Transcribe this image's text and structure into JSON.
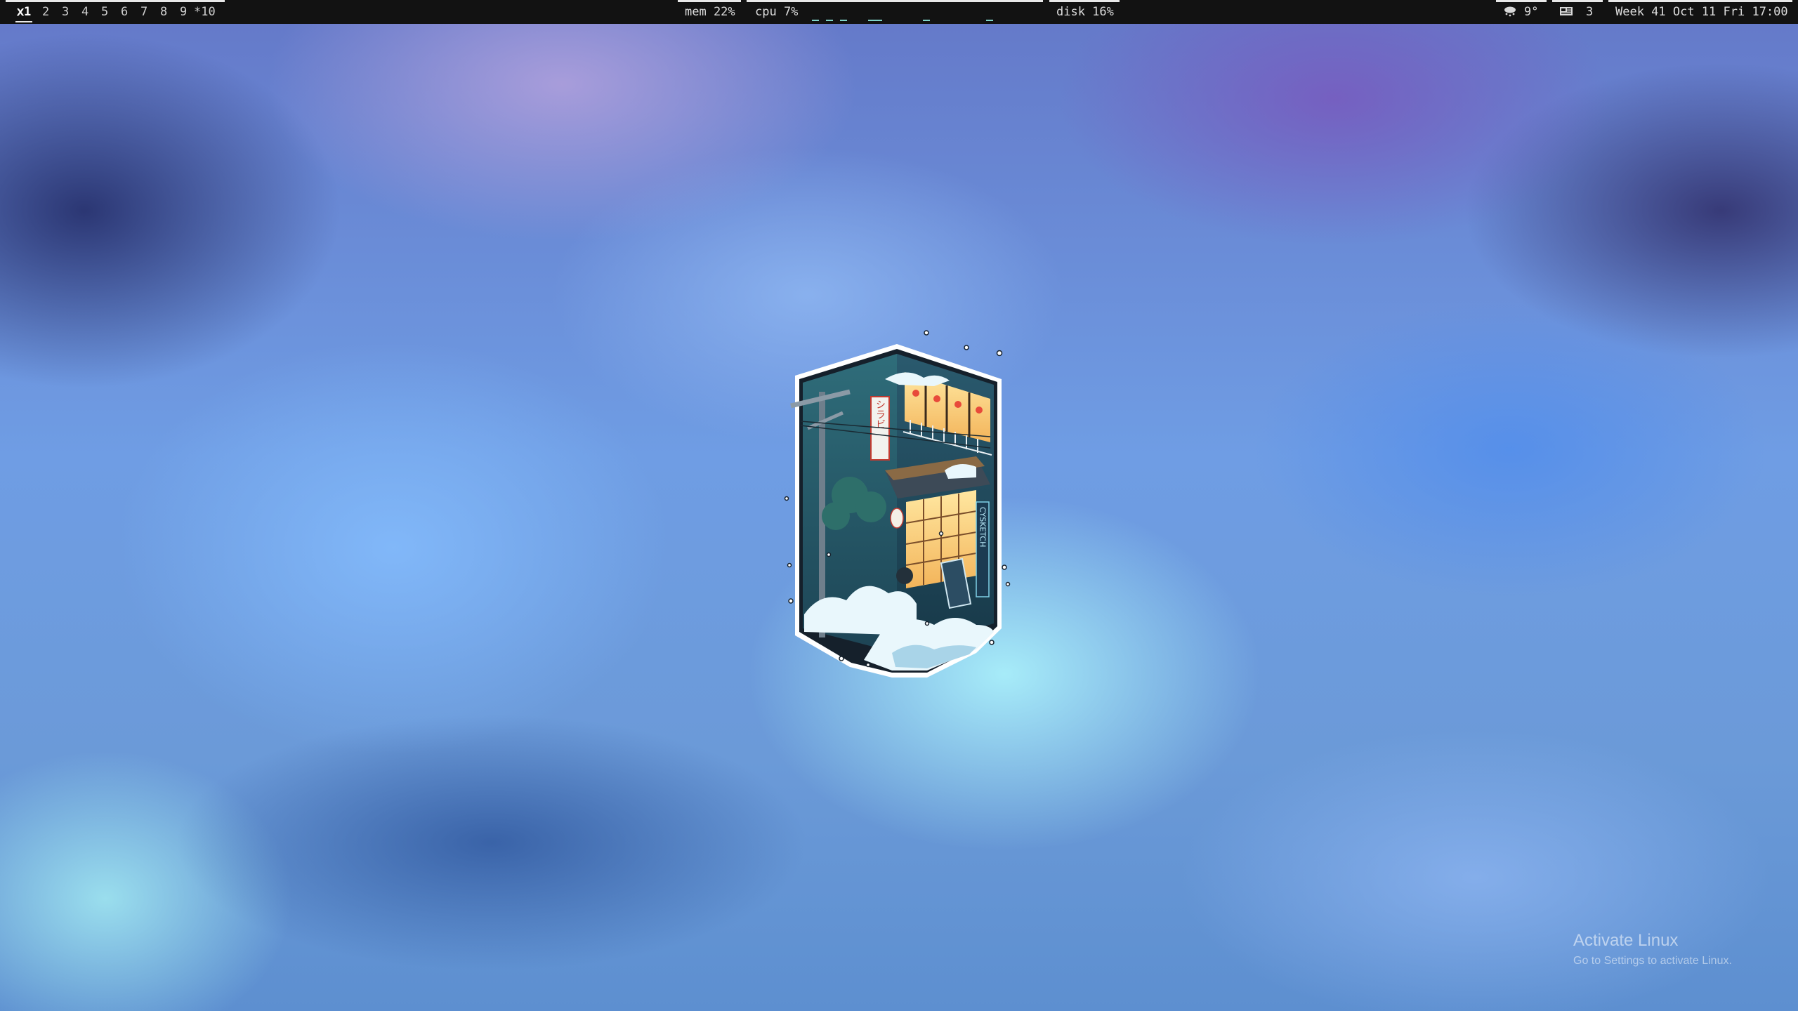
{
  "topbar": {
    "workspaces": [
      {
        "label": "ⅹ1",
        "active": true
      },
      {
        "label": "2"
      },
      {
        "label": "3"
      },
      {
        "label": "4"
      },
      {
        "label": "5"
      },
      {
        "label": "6"
      },
      {
        "label": "7"
      },
      {
        "label": "8"
      },
      {
        "label": "9"
      },
      {
        "label": "*10"
      }
    ],
    "mem": "mem 22%",
    "cpu": "cpu  7%",
    "disk": "disk 16%",
    "weather": {
      "icon": "snow-cloud-icon",
      "temp": "9°"
    },
    "news": {
      "icon": "newspaper-icon",
      "count": "3"
    },
    "clock": "Week 41 Oct 11 Fri 17:00",
    "accent_color": "#7fd4c8"
  },
  "desktop": {
    "wallpaper_art_text": {
      "vertical_sign": "シラビ",
      "side_sign": "CYSKETCH"
    }
  },
  "watermark": {
    "title": "Activate Linux",
    "subtitle": "Go to Settings to activate Linux."
  }
}
